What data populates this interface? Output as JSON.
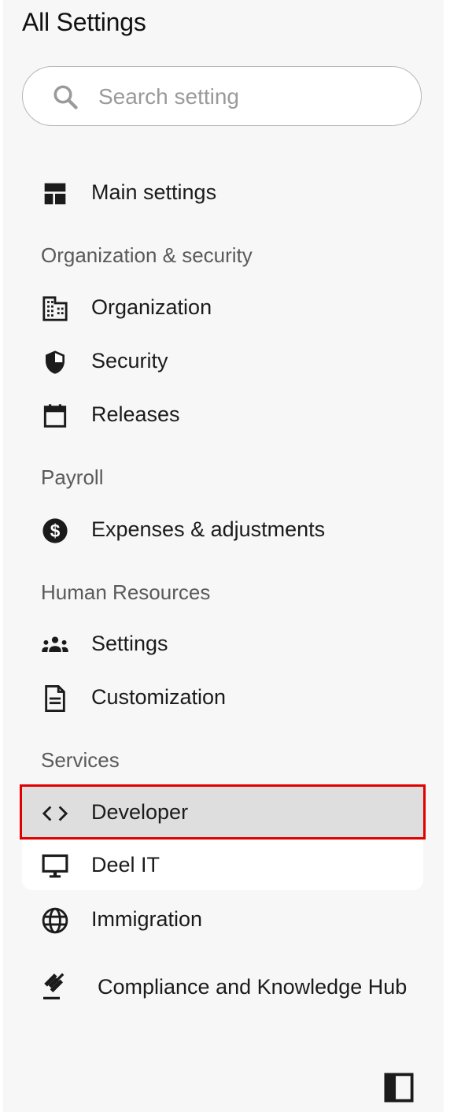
{
  "header": {
    "title": "All Settings"
  },
  "search": {
    "placeholder": "Search setting",
    "value": ""
  },
  "nav": {
    "main_settings": "Main settings",
    "sections": [
      {
        "header": "Organization & security",
        "items": [
          {
            "label": "Organization",
            "icon": "building-icon"
          },
          {
            "label": "Security",
            "icon": "shield-icon"
          },
          {
            "label": "Releases",
            "icon": "calendar-icon"
          }
        ]
      },
      {
        "header": "Payroll",
        "items": [
          {
            "label": "Expenses & adjustments",
            "icon": "dollar-circle-icon"
          }
        ]
      },
      {
        "header": "Human Resources",
        "items": [
          {
            "label": "Settings",
            "icon": "groups-icon"
          },
          {
            "label": "Customization",
            "icon": "document-icon"
          }
        ]
      },
      {
        "header": "Services",
        "items": [
          {
            "label": "Developer",
            "icon": "code-icon",
            "active": true
          },
          {
            "label": "Deel IT",
            "icon": "monitor-icon"
          },
          {
            "label": "Immigration",
            "icon": "globe-icon"
          },
          {
            "label": "Compliance and Knowledge Hub",
            "icon": "gavel-icon"
          }
        ]
      }
    ]
  },
  "colors": {
    "panel_bg": "#f7f7f7",
    "active_bg": "#dedede",
    "active_outline": "#e00000",
    "section_text": "#5a5a5a"
  }
}
